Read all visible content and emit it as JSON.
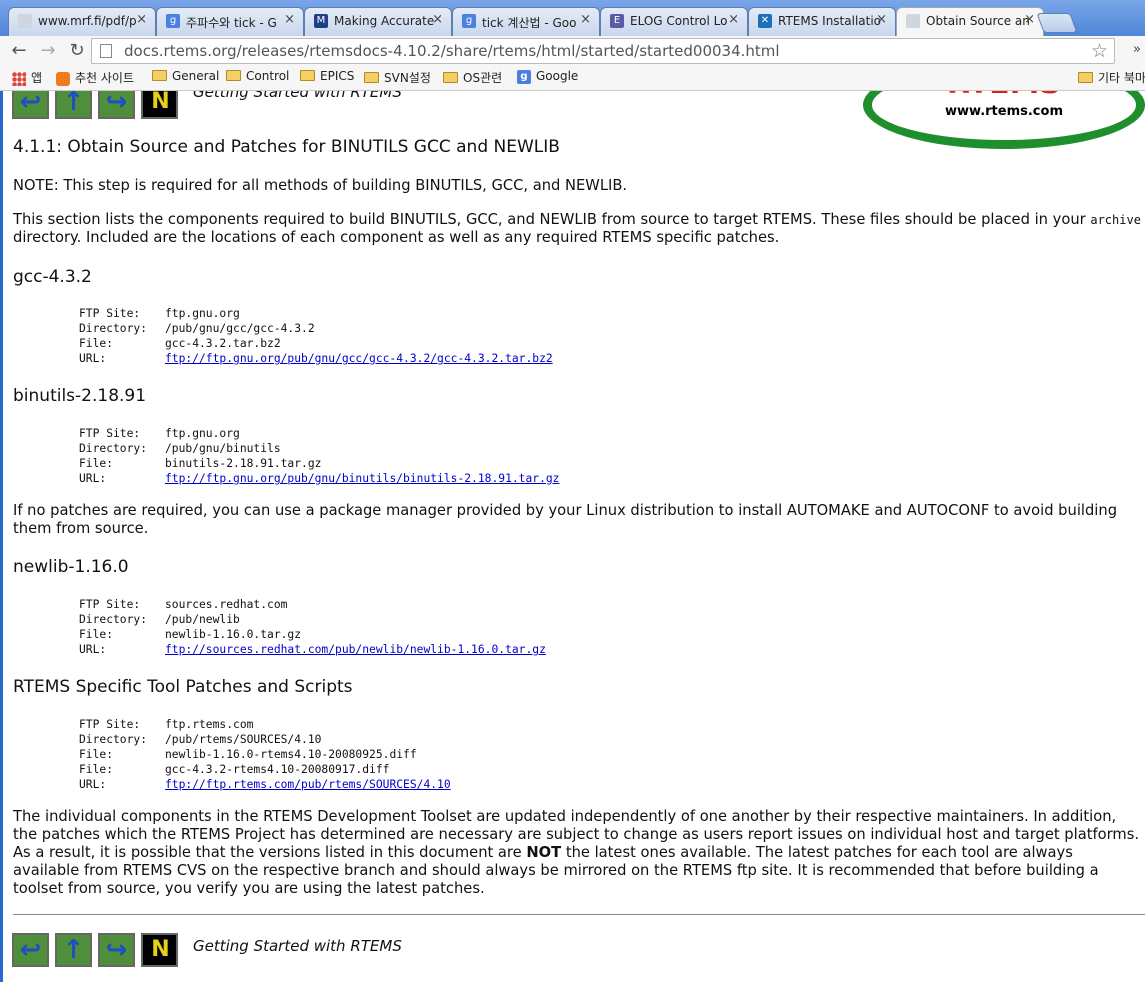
{
  "tabs": [
    {
      "title": "www.mrf.fi/pdf/p",
      "favicon": "page-icon",
      "active": false
    },
    {
      "title": "주파수와 tick - G",
      "favicon": "google-icon",
      "active": false
    },
    {
      "title": "Making Accurate",
      "favicon": "bookmark-icon",
      "active": false
    },
    {
      "title": "tick 계산법 - Goo",
      "favicon": "google-icon",
      "active": false
    },
    {
      "title": "ELOG Control Lo",
      "favicon": "elog-icon",
      "active": false
    },
    {
      "title": "RTEMS Installatio",
      "favicon": "rtems-icon",
      "active": false
    },
    {
      "title": "Obtain Source an",
      "favicon": "page-icon",
      "active": true
    }
  ],
  "toolbar": {
    "url": "docs.rtems.org/releases/rtemsdocs-4.10.2/share/rtems/html/started/started00034.html"
  },
  "bookmarks": {
    "items": [
      {
        "label": "앱",
        "icon": "apps-icon"
      },
      {
        "label": "추천 사이트",
        "icon": "recommended-icon"
      },
      {
        "label": "General",
        "icon": "folder-icon"
      },
      {
        "label": "Control",
        "icon": "folder-icon"
      },
      {
        "label": "EPICS",
        "icon": "folder-icon"
      },
      {
        "label": "SVN설정",
        "icon": "folder-icon"
      },
      {
        "label": "OS관련",
        "icon": "folder-icon"
      },
      {
        "label": "Google",
        "icon": "google-icon"
      }
    ],
    "other": "기타 북마"
  },
  "page": {
    "nav_caption": "Getting Started with RTEMS",
    "logo": {
      "brand": "RTEMS",
      "url": "www.rtems.com"
    },
    "heading": "4.1.1: Obtain Source and Patches for BINUTILS GCC and NEWLIB",
    "note": "NOTE: This step is required for all methods of building BINUTILS, GCC, and NEWLIB.",
    "intro_a": "This section lists the components required to build BINUTILS, GCC, and NEWLIB from source to target RTEMS. These files should be placed in your",
    "intro_code": "archive",
    "intro_b": " directory. Included are the locations of each component as well as any required RTEMS specific patches.",
    "sections": [
      {
        "title": "gcc-4.3.2",
        "rows": [
          {
            "key": "FTP Site:",
            "value": "ftp.gnu.org"
          },
          {
            "key": "Directory:",
            "value": "/pub/gnu/gcc/gcc-4.3.2"
          },
          {
            "key": "File:",
            "value": "gcc-4.3.2.tar.bz2"
          },
          {
            "key": "URL:",
            "value": "ftp://ftp.gnu.org/pub/gnu/gcc/gcc-4.3.2/gcc-4.3.2.tar.bz2",
            "link": true
          }
        ]
      },
      {
        "title": "binutils-2.18.91",
        "rows": [
          {
            "key": "FTP Site:",
            "value": "ftp.gnu.org"
          },
          {
            "key": "Directory:",
            "value": "/pub/gnu/binutils"
          },
          {
            "key": "File:",
            "value": "binutils-2.18.91.tar.gz"
          },
          {
            "key": "URL:",
            "value": "ftp://ftp.gnu.org/pub/gnu/binutils/binutils-2.18.91.tar.gz",
            "link": true
          }
        ]
      },
      {
        "title": "newlib-1.16.0",
        "rows": [
          {
            "key": "FTP Site:",
            "value": "sources.redhat.com"
          },
          {
            "key": "Directory:",
            "value": "/pub/newlib"
          },
          {
            "key": "File:",
            "value": "newlib-1.16.0.tar.gz"
          },
          {
            "key": "URL:",
            "value": "ftp://sources.redhat.com/pub/newlib/newlib-1.16.0.tar.gz",
            "link": true
          }
        ]
      },
      {
        "title": "RTEMS Specific Tool Patches and Scripts",
        "rows": [
          {
            "key": "FTP Site:",
            "value": "ftp.rtems.com"
          },
          {
            "key": "Directory:",
            "value": "/pub/rtems/SOURCES/4.10"
          },
          {
            "key": "File:",
            "value": "newlib-1.16.0-rtems4.10-20080925.diff"
          },
          {
            "key": "File:",
            "value": "gcc-4.3.2-rtems4.10-20080917.diff"
          },
          {
            "key": "URL:",
            "value": "ftp://ftp.rtems.com/pub/rtems/SOURCES/4.10",
            "link": true
          }
        ]
      }
    ],
    "no_patches": "If no patches are required, you can use a package manager provided by your Linux distribution to install AUTOMAKE and AUTOCONF to avoid building them from source.",
    "closing_a": "The individual components in the RTEMS Development Toolset are updated independently of one another by their respective maintainers. In addition, the patches which the RTEMS Project has determined are necessary are subject to change as users report issues on individual host and target platforms. As a result, it is possible that the versions listed in this document are ",
    "closing_bold": "NOT",
    "closing_b": " the latest ones available. The latest patches for each tool are always available from RTEMS CVS on the respective branch and should always be mirrored on the RTEMS ftp site. It is recommended that before building a toolset from source, you verify you are using the latest patches."
  }
}
